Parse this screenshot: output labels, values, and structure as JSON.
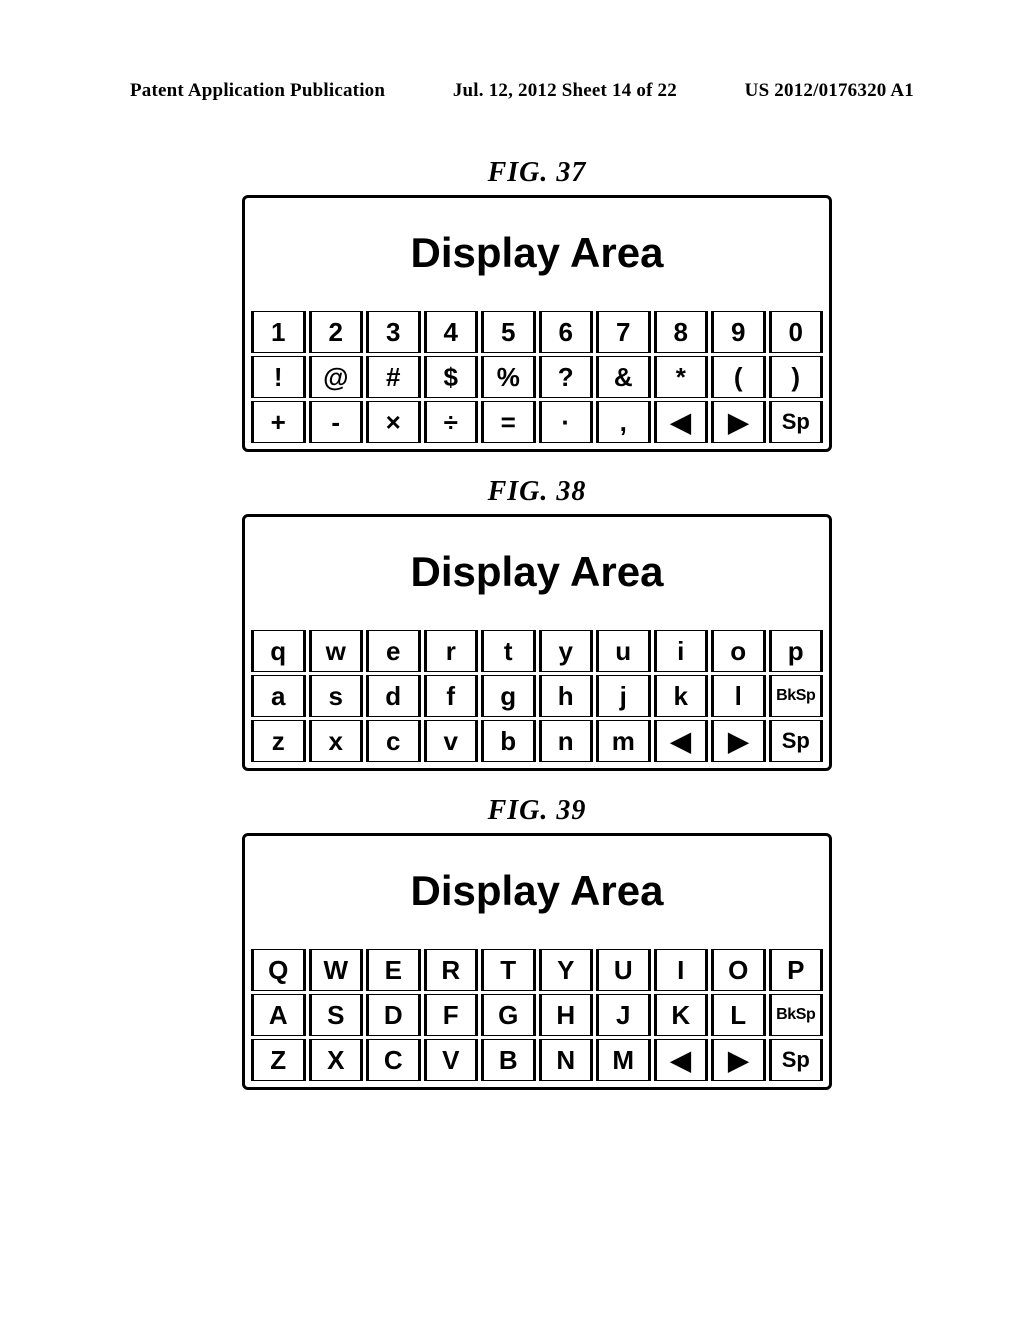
{
  "header": {
    "left": "Patent Application Publication",
    "center": "Jul. 12, 2012  Sheet 14 of 22",
    "right": "US 2012/0176320 A1"
  },
  "figures": [
    {
      "label": "FIG. 37",
      "display": "Display Area",
      "rows": [
        [
          "1",
          "2",
          "3",
          "4",
          "5",
          "6",
          "7",
          "8",
          "9",
          "0"
        ],
        [
          "!",
          "@",
          "#",
          "$",
          "%",
          "?",
          "&",
          "*",
          "(",
          ")"
        ],
        [
          "+",
          "-",
          "×",
          "÷",
          "=",
          "·",
          ",",
          "◀",
          "▶",
          "Sp"
        ]
      ],
      "smallIdx": {
        "2": [
          9
        ]
      }
    },
    {
      "label": "FIG. 38",
      "display": "Display Area",
      "rows": [
        [
          "q",
          "w",
          "e",
          "r",
          "t",
          "y",
          "u",
          "i",
          "o",
          "p"
        ],
        [
          "a",
          "s",
          "d",
          "f",
          "g",
          "h",
          "j",
          "k",
          "l",
          "BkSp"
        ],
        [
          "z",
          "x",
          "c",
          "v",
          "b",
          "n",
          "m",
          "◀",
          "▶",
          "Sp"
        ]
      ],
      "smallIdx": {
        "1": [
          9
        ],
        "2": [
          9
        ]
      }
    },
    {
      "label": "FIG. 39",
      "display": "Display Area",
      "rows": [
        [
          "Q",
          "W",
          "E",
          "R",
          "T",
          "Y",
          "U",
          "I",
          "O",
          "P"
        ],
        [
          "A",
          "S",
          "D",
          "F",
          "G",
          "H",
          "J",
          "K",
          "L",
          "BkSp"
        ],
        [
          "Z",
          "X",
          "C",
          "V",
          "B",
          "N",
          "M",
          "◀",
          "▶",
          "Sp"
        ]
      ],
      "smallIdx": {
        "1": [
          9
        ],
        "2": [
          9
        ]
      }
    }
  ]
}
